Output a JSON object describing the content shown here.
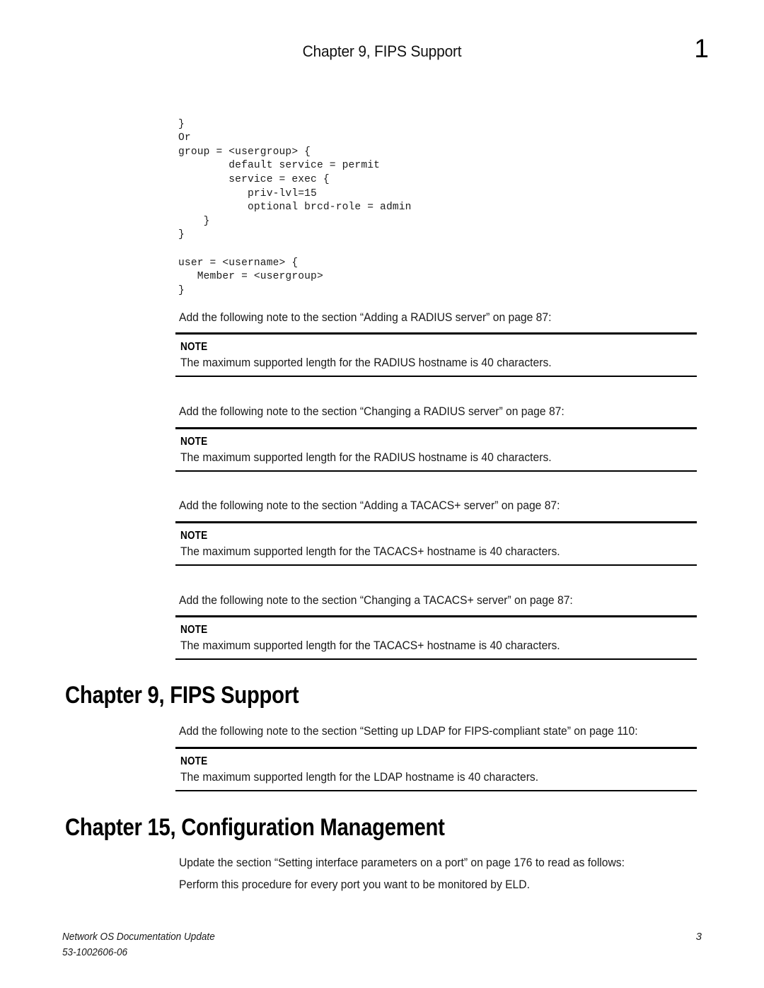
{
  "header": {
    "title": "Chapter 9, FIPS Support",
    "folio": "1"
  },
  "code_block": {
    "text": "}\nOr\ngroup = <usergroup> {\n        default service = permit\n        service = exec {\n           priv-lvl=15\n           optional brcd-role = admin\n    }\n}\n\nuser = <username> {\n   Member = <usergroup>\n}"
  },
  "sections": [
    {
      "intro": "Add the following note to the section “Adding a RADIUS server” on page 87:",
      "note_label": "NOTE",
      "note_text": "The maximum supported length for the RADIUS hostname is 40 characters."
    },
    {
      "intro": "Add the following note to the section “Changing a RADIUS server” on page 87:",
      "note_label": "NOTE",
      "note_text": "The maximum supported length for the RADIUS hostname is 40 characters."
    },
    {
      "intro": "Add the following note to the section “Adding a TACACS+ server” on page 87:",
      "note_label": "NOTE",
      "note_text": "The maximum supported length for the TACACS+ hostname is 40 characters."
    },
    {
      "intro": "Add the following note to the section “Changing a TACACS+ server” on page 87:",
      "note_label": "NOTE",
      "note_text": "The maximum supported length for the TACACS+ hostname is 40 characters."
    }
  ],
  "chapter_fips": {
    "heading": "Chapter 9, FIPS Support",
    "intro": "Add the following note to the section “Setting up LDAP for FIPS-compliant state” on page 110:",
    "note_label": "NOTE",
    "note_text": "The maximum supported length for the LDAP hostname is 40 characters."
  },
  "chapter_config": {
    "heading": "Chapter 15, Configuration Management",
    "para1": "Update the section “Setting interface parameters on a port” on page 176 to read as follows:",
    "para2": "Perform this procedure for every port you want to be monitored by ELD."
  },
  "footer": {
    "doc_title": "Network OS Documentation Update",
    "doc_number": "53-1002606-06",
    "folio": "3"
  }
}
